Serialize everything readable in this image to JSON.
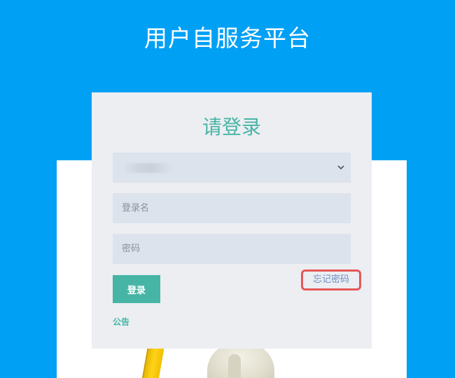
{
  "header": {
    "title": "用户自服务平台"
  },
  "login": {
    "heading": "请登录",
    "domain_select": {
      "selected_value": "_",
      "chevron_icon": "chevron-down-icon"
    },
    "username": {
      "value": "",
      "placeholder": "登录名"
    },
    "password": {
      "value": "",
      "placeholder": "密码"
    },
    "submit_label": "登录",
    "forgot_password_label": "忘记密码",
    "notice_label": "公告"
  },
  "colors": {
    "background": "#00a0f5",
    "accent": "#47b5a5",
    "panel": "#eceef2",
    "field": "#dde3ec",
    "highlight_border": "#e5575a",
    "link": "#6b8fc4"
  }
}
